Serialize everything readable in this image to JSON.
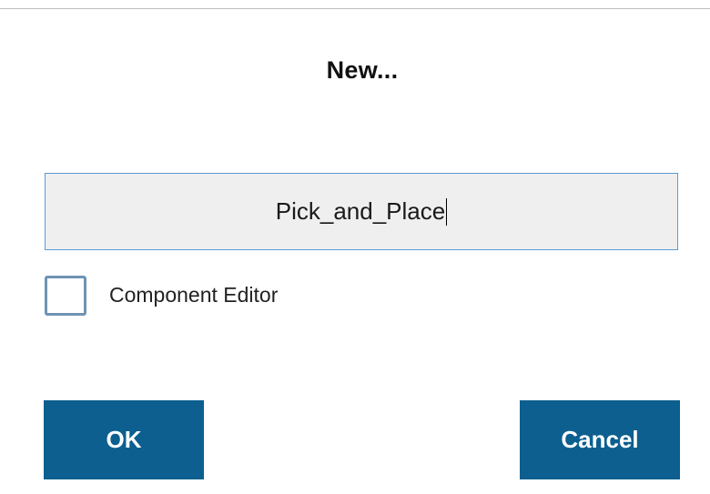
{
  "dialog": {
    "title": "New...",
    "name_field": {
      "value": "Pick_and_Place",
      "has_focus": true
    },
    "component_editor_checkbox": {
      "label": "Component Editor",
      "checked": false
    },
    "buttons": {
      "ok_label": "OK",
      "cancel_label": "Cancel"
    },
    "colors": {
      "button_bg": "#0c5f8f",
      "button_text": "#ffffff",
      "field_border_focus": "#5b9bd5",
      "field_bg": "#efefef",
      "checkbox_border": "#6f93b3"
    }
  }
}
